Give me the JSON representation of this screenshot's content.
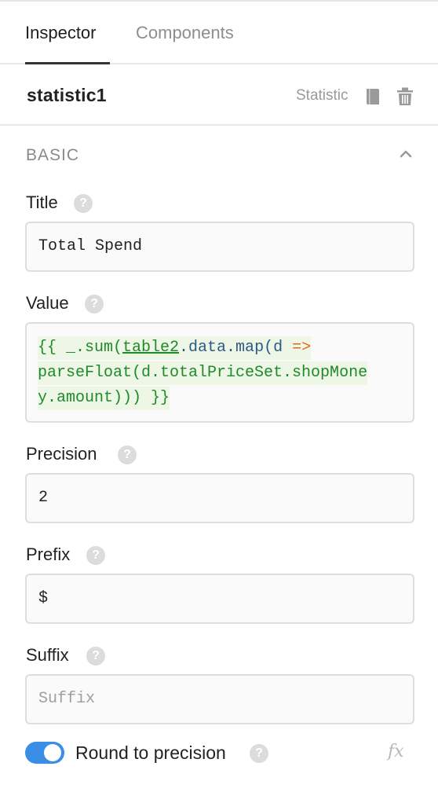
{
  "tabs": [
    {
      "label": "Inspector",
      "active": true
    },
    {
      "label": "Components",
      "active": false
    }
  ],
  "component": {
    "name": "statistic1",
    "type_label": "Statistic",
    "doc_icon": "book-icon",
    "delete_icon": "trash-icon"
  },
  "section": {
    "title": "BASIC",
    "collapse_icon": "chevron-up-icon"
  },
  "fields": {
    "title": {
      "label": "Title",
      "value": "Total Spend"
    },
    "value": {
      "label": "Value",
      "code_lines": [
        {
          "pre": "{{ _.sum(",
          "ident": "table2",
          "mid": ".data.map(d ",
          "arrow": "=>",
          "post": ""
        },
        {
          "text": "parseFloat(d.totalPriceSet.shopMone"
        },
        {
          "text": "y.amount))) }}"
        }
      ]
    },
    "precision": {
      "label": "Precision",
      "value": "2"
    },
    "prefix": {
      "label": "Prefix",
      "value": "$"
    },
    "suffix": {
      "label": "Suffix",
      "value": "",
      "placeholder": "Suffix"
    }
  },
  "help_glyph": "?",
  "toggle": {
    "label": "Round to precision",
    "on": true
  },
  "fx_label": "fx",
  "colors": {
    "accent": "#3a8ee6",
    "code_green": "#1f8a2a",
    "code_arrow": "#e06a1a"
  }
}
